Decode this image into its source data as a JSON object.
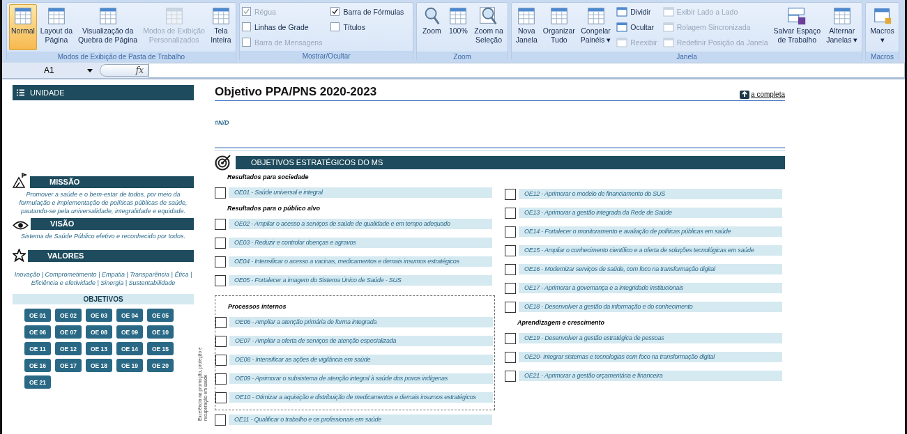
{
  "ribbon": {
    "groups": [
      {
        "label": "Modos de Exibição de Pasta de Trabalho",
        "columns": [
          [
            {
              "kind": "large",
              "label": "Normal",
              "selected": true,
              "disabled": false
            }
          ],
          [
            {
              "kind": "large",
              "label": "Layout da\nPágina",
              "selected": false,
              "disabled": false
            }
          ],
          [
            {
              "kind": "large",
              "label": "Visualização da\nQuebra de Página",
              "selected": false,
              "disabled": false
            }
          ],
          [
            {
              "kind": "large",
              "label": "Modos de Exibição\nPersonalizados",
              "selected": false,
              "disabled": true
            }
          ],
          [
            {
              "kind": "large",
              "label": "Tela\nInteira",
              "selected": false,
              "disabled": false
            }
          ]
        ]
      },
      {
        "label": "Mostrar/Ocultar",
        "columns": [
          [
            {
              "kind": "check",
              "label": "Régua",
              "checked": true,
              "disabled": true
            },
            {
              "kind": "check",
              "label": "Linhas de Grade",
              "checked": false,
              "disabled": false
            },
            {
              "kind": "check",
              "label": "Barra de Mensagens",
              "checked": false,
              "disabled": true
            }
          ],
          [
            {
              "kind": "check",
              "label": "Barra de Fórmulas",
              "checked": true,
              "disabled": false
            },
            {
              "kind": "check",
              "label": "Títulos",
              "checked": false,
              "disabled": false
            }
          ]
        ]
      },
      {
        "label": "Zoom",
        "columns": [
          [
            {
              "kind": "large",
              "label": "Zoom",
              "selected": false,
              "disabled": false
            }
          ],
          [
            {
              "kind": "large",
              "label": "100%",
              "selected": false,
              "disabled": false
            }
          ],
          [
            {
              "kind": "large",
              "label": "Zoom na\nSeleção",
              "selected": false,
              "disabled": false
            }
          ]
        ]
      },
      {
        "label": "Janela",
        "columns": [
          [
            {
              "kind": "large",
              "label": "Nova\nJanela",
              "selected": false,
              "disabled": false
            }
          ],
          [
            {
              "kind": "large",
              "label": "Organizar\nTudo",
              "selected": false,
              "disabled": false
            }
          ],
          [
            {
              "kind": "large",
              "label": "Congelar\nPainéis ▾",
              "selected": false,
              "disabled": false
            }
          ],
          [
            {
              "kind": "small",
              "label": "Dividir",
              "disabled": false
            },
            {
              "kind": "small",
              "label": "Ocultar",
              "disabled": false
            },
            {
              "kind": "small",
              "label": "Reexibir",
              "disabled": true
            }
          ],
          [
            {
              "kind": "small",
              "label": "Exibir Lado a Lado",
              "disabled": true
            },
            {
              "kind": "small",
              "label": "Rolagem Sincronizada",
              "disabled": true
            },
            {
              "kind": "small",
              "label": "Redefinir Posição da Janela",
              "disabled": true
            }
          ],
          [
            {
              "kind": "large",
              "label": "Salvar Espaço\nde Trabalho",
              "selected": false,
              "disabled": false
            }
          ],
          [
            {
              "kind": "large",
              "label": "Alternar\nJanelas ▾",
              "selected": false,
              "disabled": false
            }
          ]
        ]
      },
      {
        "label": "Macros",
        "columns": [
          [
            {
              "kind": "large",
              "label": "Macros\n▾",
              "selected": false,
              "disabled": false
            }
          ]
        ]
      }
    ]
  },
  "formula_bar": {
    "name_box": "A1",
    "fx_label": "fx"
  },
  "sidebar": {
    "unit_header": "UNIDADE",
    "mission": {
      "title": "MISSÃO",
      "text": "Promover a saúde e o bem-estar de todos, por meio da formulação e implementação de políticas públicas de saúde, pautando-se pela universalidade, integralidade e equidade."
    },
    "vision": {
      "title": "VISÃO",
      "text": "Sistema de Saúde Público efetivo e reconhecido por todos."
    },
    "values": {
      "title": "VALORES",
      "text": "Inovação | Comprometimento | Empatia | Transparência | Ética | Eficiência e efetividade | Sinergia | Sustentabilidade"
    },
    "objectives": {
      "title": "OBJETIVOS",
      "buttons": [
        "OE 01",
        "OE 02",
        "OE 03",
        "OE 04",
        "OE 05",
        "OE 06",
        "OE 07",
        "OE 08",
        "OE 09",
        "OE 10",
        "OE 11",
        "OE 12",
        "OE 13",
        "OE 14",
        "OE 15",
        "OE 16",
        "OE 17",
        "OE 18",
        "OE 19",
        "OE 20",
        "OE 21"
      ]
    }
  },
  "main": {
    "title": "Objetivo PPA/PNS 2020-2023",
    "link": "a completa",
    "value": "#N/D",
    "section_header": "OBJETIVOS ESTRATÉGICOS DO MS",
    "side_label": "Excelência na promoção, proteção e recuperação em saúde",
    "left_column": [
      {
        "heading": "Resultados para sociedade",
        "items": [
          {
            "text": "OE01 - Saúde universal e integral",
            "checked": false
          }
        ]
      },
      {
        "heading": "Resultados para o público alvo",
        "items": [
          {
            "text": "OE02 - Ampliar o acesso a serviços de saúde de qualidade e em tempo adequado",
            "checked": false
          },
          {
            "text": "OE03 - Reduzir e controlar doenças e agravos",
            "checked": false
          },
          {
            "text": "OE04 - Intensificar o acesso a vacinas, medicamentos e demais insumos estratégicos",
            "checked": false
          },
          {
            "text": "OE05 - Fortalecer a imagem do Sistema Único de Saúde - SUS",
            "checked": false
          }
        ]
      },
      {
        "heading": "Processos internos",
        "framed": true,
        "items": [
          {
            "text": "OE06 - Ampliar a atenção primária de forma integrada",
            "checked": false
          },
          {
            "text": "OE07 - Ampliar a oferta de serviços de atenção especializada",
            "checked": false
          },
          {
            "text": "OE08 - Intensificar as ações de vigilância em saúde",
            "checked": false
          },
          {
            "text": "OE09 - Aprimorar o subsistema de atenção integral à saúde dos povos indígenas",
            "checked": false
          },
          {
            "text": "OE10 - Otimizar a aquisição e distribuição de medicamentos e demais insumos estratégicos",
            "checked": false
          }
        ]
      },
      {
        "items": [
          {
            "text": "OE11 - Qualificar o trabalho e os profissionais em saúde",
            "checked": false
          }
        ]
      }
    ],
    "right_column": [
      {
        "items": [
          {
            "text": "OE12 - Aprimorar o modelo de financiamento do SUS",
            "checked": false
          },
          {
            "text": "OE13 - Aprimorar a gestão integrada da Rede de Saúde",
            "checked": false
          },
          {
            "text": "OE14 - Fortalecer o monitoramento e avaliação de políticas públicas em saúde",
            "checked": false
          },
          {
            "text": "OE15 - Ampliar o conhecimento científico e a oferta de soluções tecnológicas em saúde",
            "checked": false
          },
          {
            "text": "OE16 - Modernizar serviços de saúde, com foco na transformação digital",
            "checked": false
          },
          {
            "text": "OE17 - Aprimorar a governança e a integridade institucionais",
            "checked": false
          },
          {
            "text": "OE18 - Desenvolver a gestão da informação e do conhecimento",
            "checked": false
          }
        ]
      },
      {
        "heading": "Aprendizagem e crescimento",
        "items": [
          {
            "text": "OE19 - Desenvolver a gestão estratégica de pessoas",
            "checked": false
          },
          {
            "text": "OE20- Integrar sistemas e tecnologias com foco na transformação digital",
            "checked": false
          },
          {
            "text": "OE21 - Aprimorar a gestão orçamentária e financeira",
            "checked": false
          }
        ]
      }
    ]
  }
}
